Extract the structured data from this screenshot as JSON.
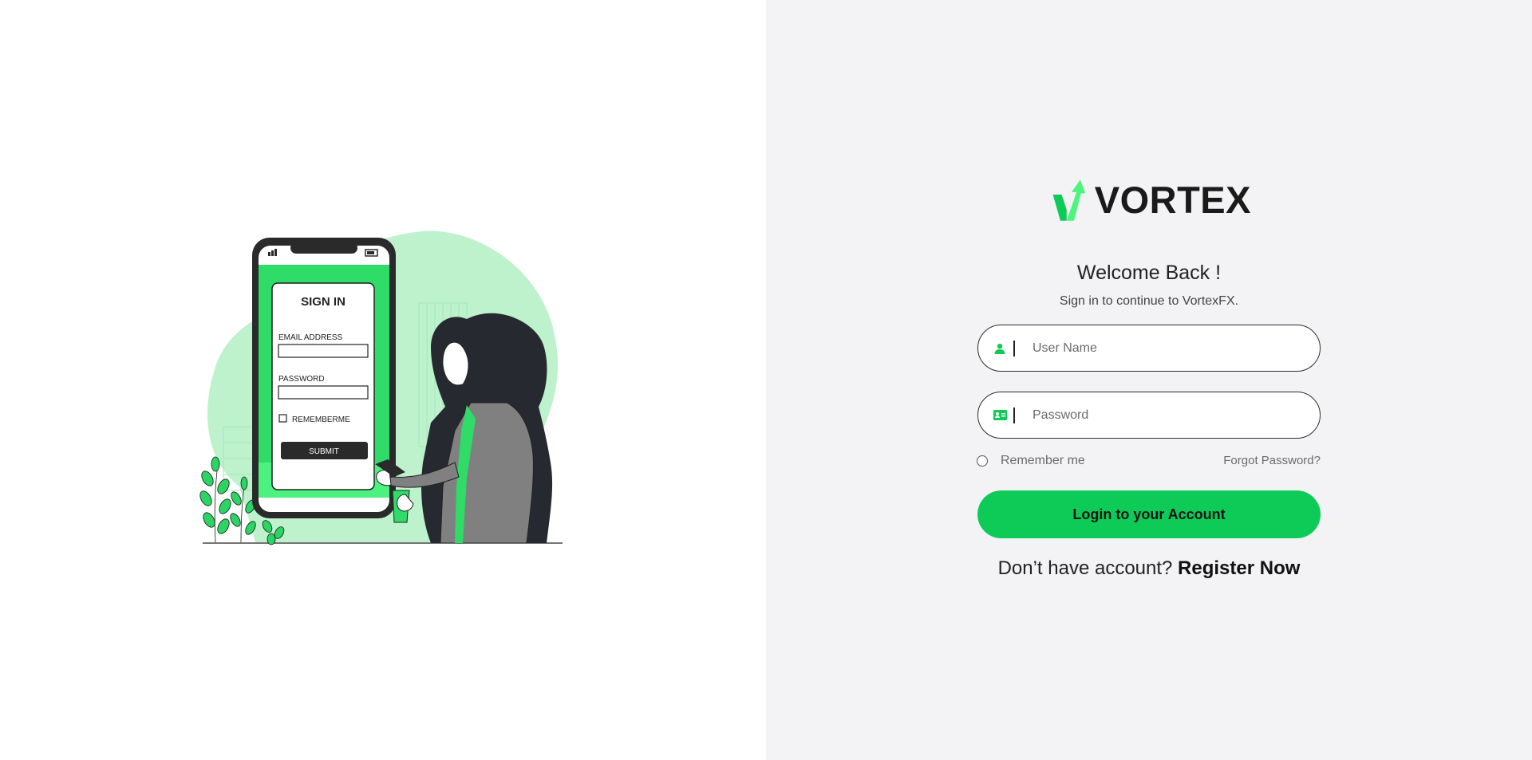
{
  "brand": {
    "name": "VORTEX",
    "accent": "#0ecb57",
    "accent_light": "#4df57f"
  },
  "illustration": {
    "phone_title": "SIGN IN",
    "email_label": "EMAIL ADDRESS",
    "password_label": "PASSWORD",
    "remember_label": "REMEMBERME",
    "submit_label": "SUBMIT"
  },
  "login": {
    "welcome": "Welcome Back !",
    "subtitle": "Sign in to continue to VortexFX.",
    "username_placeholder": "User Name",
    "password_placeholder": "Password",
    "remember_label": "Remember me",
    "forgot_label": "Forgot Password?",
    "submit_label": "Login to your Account",
    "register_prompt": "Don’t have account?",
    "register_link": "Register Now"
  },
  "icons": {
    "username": "user-icon",
    "password": "id-card-icon",
    "logo": "vortex-check-arrow-icon"
  }
}
